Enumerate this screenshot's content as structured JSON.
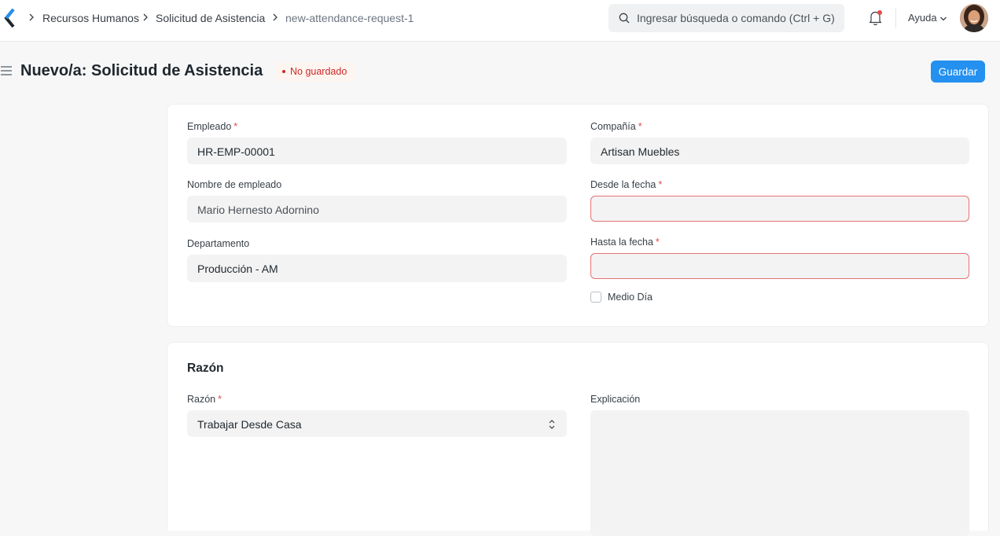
{
  "navbar": {
    "breadcrumbs": [
      "Recursos Humanos",
      "Solicitud de Asistencia",
      "new-attendance-request-1"
    ],
    "search_placeholder": "Ingresar búsqueda o comando (Ctrl + G)",
    "help_label": "Ayuda",
    "icons": [
      "app-logo-icon",
      "chevron-right-icon",
      "search-icon",
      "bell-icon",
      "chevron-down-icon",
      "avatar"
    ],
    "accent_color": "#2490ef"
  },
  "page": {
    "title": "Nuevo/a: Solicitud de Asistencia",
    "status": "No guardado",
    "save_label": "Guardar"
  },
  "form": {
    "employee": {
      "label": "Empleado",
      "required": "*",
      "value": "HR-EMP-00001"
    },
    "employee_name": {
      "label": "Nombre de empleado",
      "value": "Mario Hernesto Adornino"
    },
    "department": {
      "label": "Departamento",
      "value": "Producción - AM"
    },
    "company": {
      "label": "Compañía",
      "required": "*",
      "value": "Artisan Muebles"
    },
    "from_date": {
      "label": "Desde la fecha",
      "required": "*",
      "value": ""
    },
    "to_date": {
      "label": "Hasta la fecha",
      "required": "*",
      "value": ""
    },
    "half_day": {
      "label": "Medio Día",
      "checked": false
    }
  },
  "reason_section": {
    "title": "Razón",
    "reason": {
      "label": "Razón",
      "required": "*",
      "value": "Trabajar Desde Casa"
    },
    "explanation": {
      "label": "Explicación",
      "value": ""
    }
  }
}
